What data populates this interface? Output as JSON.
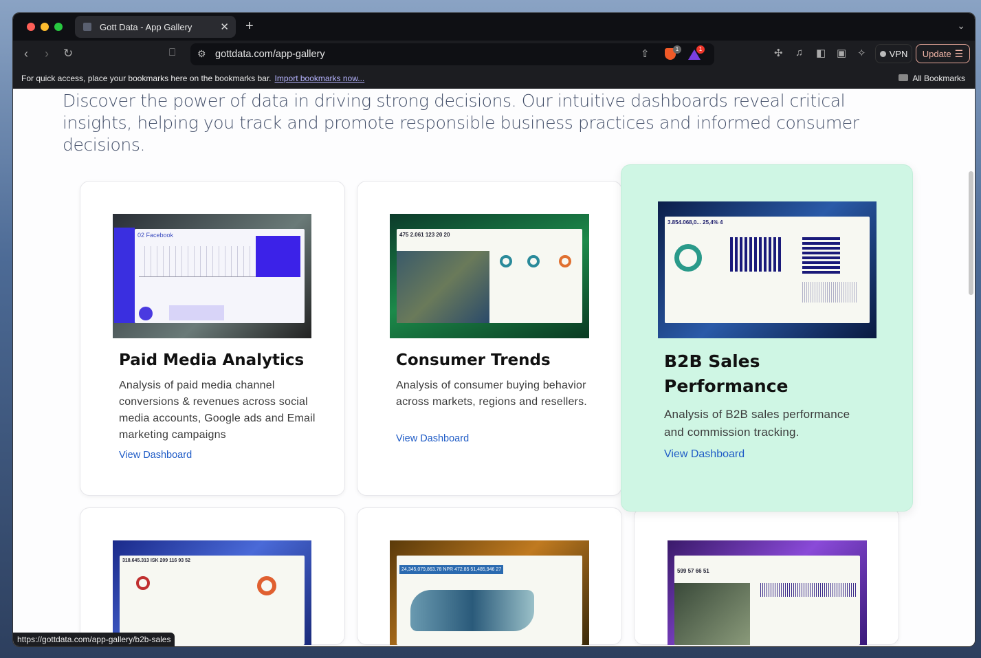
{
  "browser": {
    "tab_title": "Gott Data - App Gallery",
    "url": "gottdata.com/app-gallery",
    "shields_badge": "1",
    "rewards_badge": "1",
    "vpn_label": "VPN",
    "update_label": "Update",
    "bookmarks_prompt": "For quick access, place your bookmarks here on the bookmarks bar.",
    "import_link": "Import bookmarks now...",
    "all_bookmarks": "All Bookmarks",
    "status_url": "https://gottdata.com/app-gallery/b2b-sales"
  },
  "page": {
    "intro": "Discover the power of data in driving strong decisions. Our intuitive dashboards reveal critical insights, helping you track and promote responsible business practices and informed consumer decisions.",
    "cards": [
      {
        "title": "Paid Media Analytics",
        "description": "Analysis of paid media channel conversions & revenues across social media accounts, Google ads and Email marketing campaigns",
        "link": "View Dashboard",
        "thumb_text": "02 Facebook"
      },
      {
        "title": "Consumer Trends",
        "description": "Analysis of consumer buying behavior across markets, regions and resellers.",
        "link": "View Dashboard",
        "thumb_text": "475   2.061   123   20   20"
      },
      {
        "title": "B2B Sales Performance",
        "description": "Analysis of B2B sales performance and commission tracking.",
        "link": "View Dashboard",
        "thumb_text": "3.854.068,0...   25,4%   4"
      },
      {
        "thumb_text": "318.645.313 ISK   209   116   93   52"
      },
      {
        "thumb_text": "24,345,079,863.78   NPR 472.85   51,485,946   27"
      },
      {
        "thumb_text": "599   57   66   51"
      }
    ]
  },
  "colors": {
    "highlight": "#cff6e4",
    "link": "#1e5bc6",
    "accent_update": "#f3b6a8"
  }
}
